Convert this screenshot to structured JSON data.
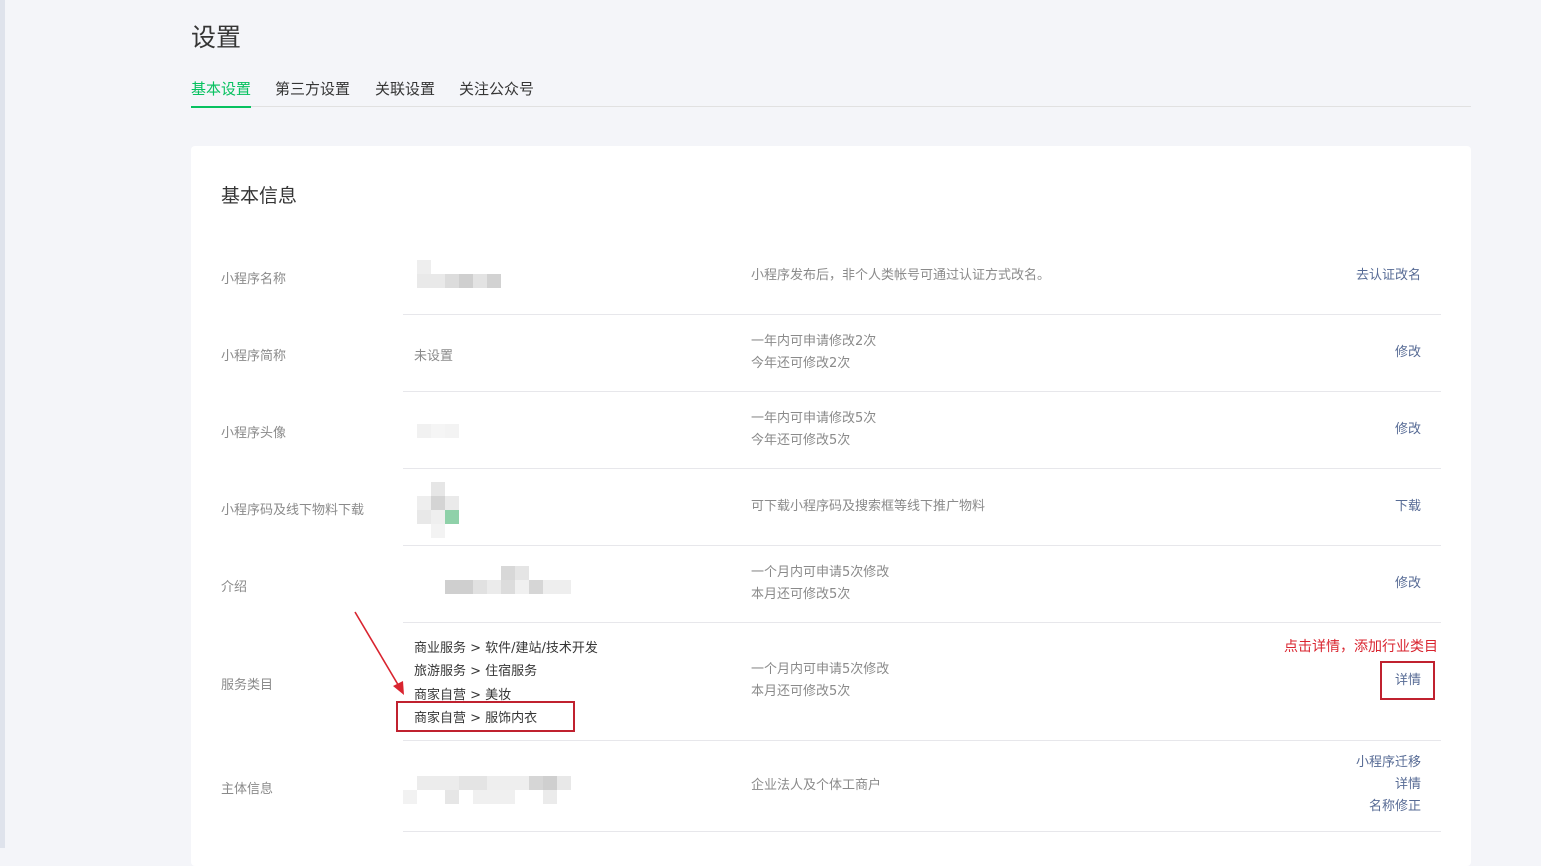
{
  "page": {
    "title": "设置"
  },
  "tabs": [
    {
      "label": "基本设置",
      "active": true
    },
    {
      "label": "第三方设置",
      "active": false
    },
    {
      "label": "关联设置",
      "active": false
    },
    {
      "label": "关注公众号",
      "active": false
    }
  ],
  "section": {
    "title": "基本信息"
  },
  "rows": {
    "name": {
      "label": "小程序名称",
      "desc": "小程序发布后，非个人类帐号可通过认证方式改名。",
      "action": "去认证改名"
    },
    "short_name": {
      "label": "小程序简称",
      "value": "未设置",
      "desc1": "一年内可申请修改2次",
      "desc2": "今年还可修改2次",
      "action": "修改"
    },
    "avatar": {
      "label": "小程序头像",
      "desc1": "一年内可申请修改5次",
      "desc2": "今年还可修改5次",
      "action": "修改"
    },
    "qrcode": {
      "label": "小程序码及线下物料下载",
      "desc": "可下载小程序码及搜索框等线下推广物料",
      "action": "下载"
    },
    "intro": {
      "label": "介绍",
      "desc1": "一个月内可申请5次修改",
      "desc2": "本月还可修改5次",
      "action": "修改"
    },
    "category": {
      "label": "服务类目",
      "items": [
        "商业服务 > 软件/建站/技术开发",
        "旅游服务 > 住宿服务",
        "商家自营 > 美妆",
        "商家自营 > 服饰内衣"
      ],
      "desc1": "一个月内可申请5次修改",
      "desc2": "本月还可修改5次",
      "action": "详情",
      "annotation": "点击详情，添加行业类目"
    },
    "entity": {
      "label": "主体信息",
      "desc": "企业法人及个体工商户",
      "actions": [
        "小程序迁移",
        "详情",
        "名称修正"
      ]
    }
  },
  "colors": {
    "accent": "#07c160",
    "link": "#576b95",
    "highlight": "#c0212f",
    "annotation": "#d9242f"
  }
}
